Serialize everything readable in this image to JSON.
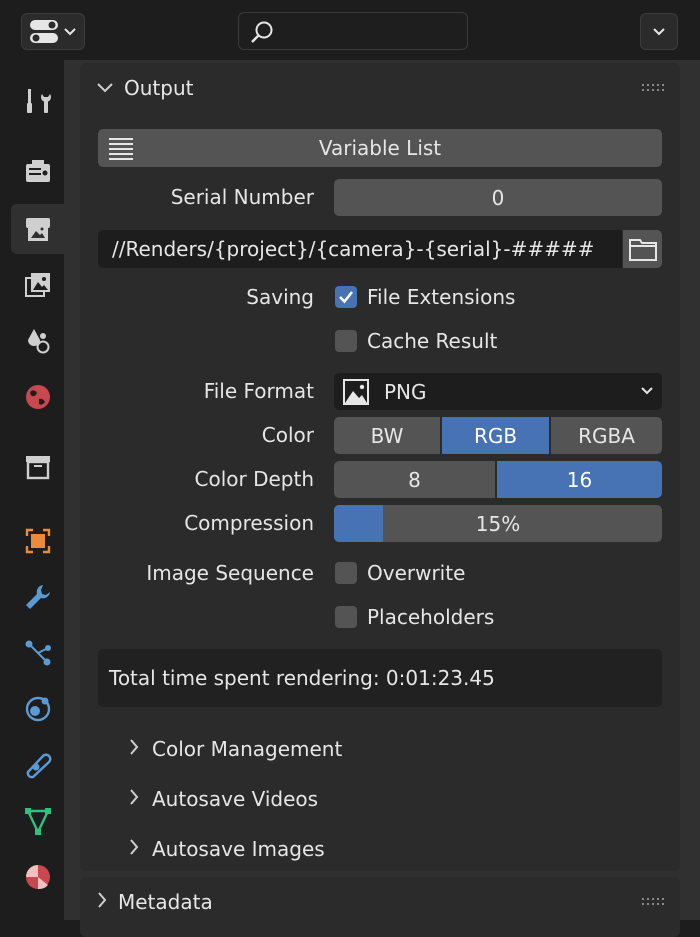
{
  "topbar": {
    "editor_type_icon": "properties-editor-icon",
    "search_placeholder": "",
    "menu_icon": "chevron-down-icon"
  },
  "sidebar": {
    "tabs": [
      {
        "name": "tool",
        "icon": "tool-icon",
        "active": false
      },
      {
        "name": "render",
        "icon": "render-icon",
        "active": false
      },
      {
        "name": "output",
        "icon": "output-icon",
        "active": true
      },
      {
        "name": "view-layer",
        "icon": "view-layer-icon",
        "active": false
      },
      {
        "name": "scene",
        "icon": "scene-icon",
        "active": false
      },
      {
        "name": "world",
        "icon": "world-icon",
        "active": false
      },
      {
        "name": "collection",
        "icon": "collection-icon",
        "active": false
      },
      {
        "name": "object",
        "icon": "object-icon",
        "active": false
      },
      {
        "name": "modifiers",
        "icon": "wrench-icon",
        "active": false
      },
      {
        "name": "particles",
        "icon": "particles-icon",
        "active": false
      },
      {
        "name": "physics",
        "icon": "physics-icon",
        "active": false
      },
      {
        "name": "constraints",
        "icon": "constraints-icon",
        "active": false
      },
      {
        "name": "data",
        "icon": "mesh-data-icon",
        "active": false
      },
      {
        "name": "material",
        "icon": "material-icon",
        "active": false
      }
    ]
  },
  "output_panel": {
    "title": "Output",
    "variable_list_label": "Variable List",
    "serial_number_label": "Serial Number",
    "serial_number_value": "0",
    "path_value": "//Renders/{project}/{camera}-{serial}-#####",
    "saving_label": "Saving",
    "file_extensions_label": "File Extensions",
    "file_extensions_checked": true,
    "cache_result_label": "Cache Result",
    "cache_result_checked": false,
    "file_format_label": "File Format",
    "file_format_value": "PNG",
    "color_label": "Color",
    "color_options": [
      "BW",
      "RGB",
      "RGBA"
    ],
    "color_selected": "RGB",
    "color_depth_label": "Color Depth",
    "color_depth_options": [
      "8",
      "16"
    ],
    "color_depth_selected": "16",
    "compression_label": "Compression",
    "compression_value": "15%",
    "compression_fraction": 0.15,
    "image_sequence_label": "Image Sequence",
    "overwrite_label": "Overwrite",
    "overwrite_checked": false,
    "placeholders_label": "Placeholders",
    "placeholders_checked": false,
    "info_text": "Total time spent rendering: 0:01:23.45",
    "subpanels": [
      "Color Management",
      "Autosave Videos",
      "Autosave Images"
    ]
  },
  "metadata_panel": {
    "title": "Metadata"
  },
  "colors": {
    "accent": "#4772b3",
    "panel": "#2b2b2b",
    "widget": "#545454"
  }
}
